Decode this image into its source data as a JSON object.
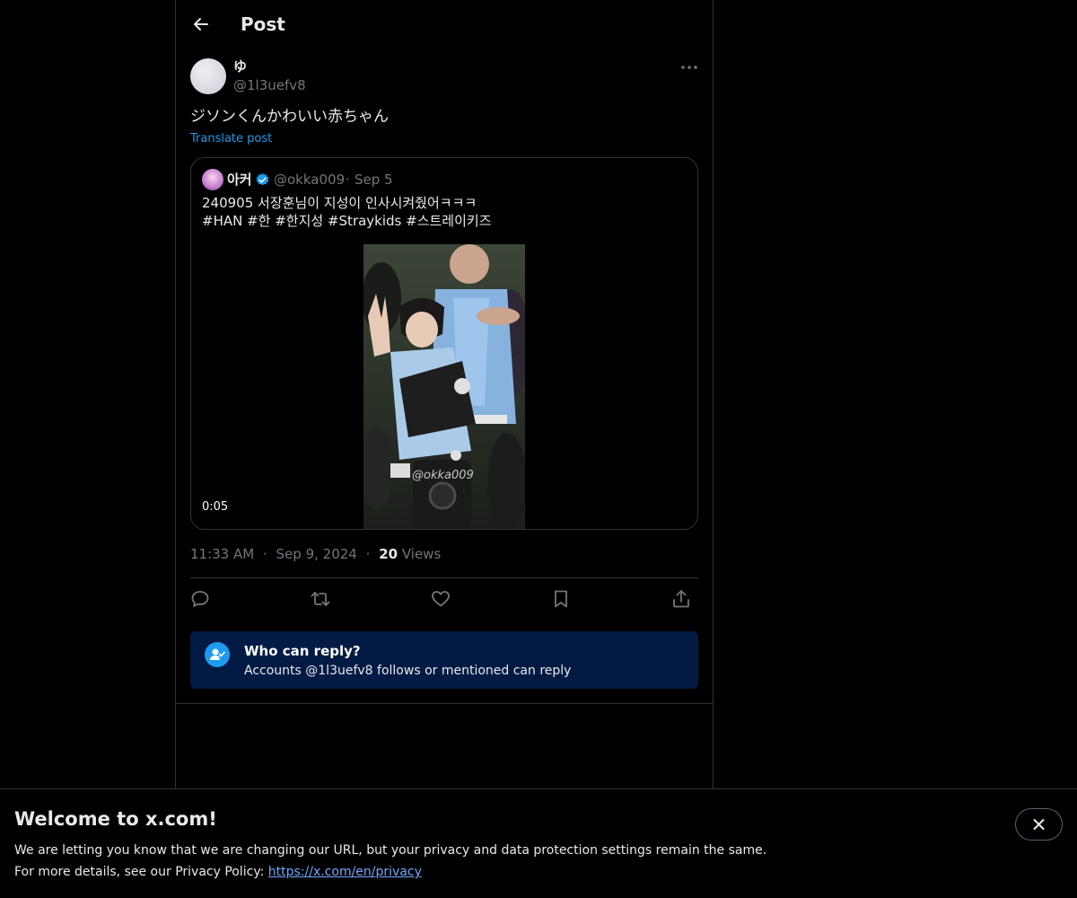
{
  "header": {
    "title": "Post"
  },
  "post": {
    "display_name": "ゆ",
    "handle": "@1l3uefv8",
    "text": "ジソンくんかわいい赤ちゃん",
    "translate_label": "Translate post",
    "time": "11:33 AM",
    "date": "Sep 9, 2024",
    "views_count": "20",
    "views_label": "Views",
    "separator": "·"
  },
  "quote": {
    "display_name": "아커",
    "handle": "@okka009",
    "date": "Sep 5",
    "line1": "240905 서장훈님이 지성이 인사시켜줬어ㅋㅋㅋ",
    "line2": "#HAN #한 #한지성 #Straykids #스트레이키즈",
    "video_time": "0:05",
    "watermark": "@okka009"
  },
  "reply_settings": {
    "title": "Who can reply?",
    "subtitle": "Accounts @1l3uefv8 follows or mentioned can reply"
  },
  "banner": {
    "title": "Welcome to x.com!",
    "line1": "We are letting you know that we are changing our URL, but your privacy and data protection settings remain the same.",
    "line2_prefix": "For more details, see our Privacy Policy: ",
    "link": "https://x.com/en/privacy"
  },
  "icons": {
    "back": "arrow-left-icon",
    "more": "ellipsis-icon",
    "verified": "verified-badge-icon",
    "reply": "speech-bubble-icon",
    "repost": "repost-icon",
    "like": "heart-icon",
    "bookmark": "bookmark-icon",
    "share": "share-icon",
    "reply_settings": "person-check-icon",
    "close": "close-icon"
  },
  "colors": {
    "accent": "#1d9bf0",
    "reply_box_bg": "#031a45",
    "muted_text": "#71767b"
  }
}
